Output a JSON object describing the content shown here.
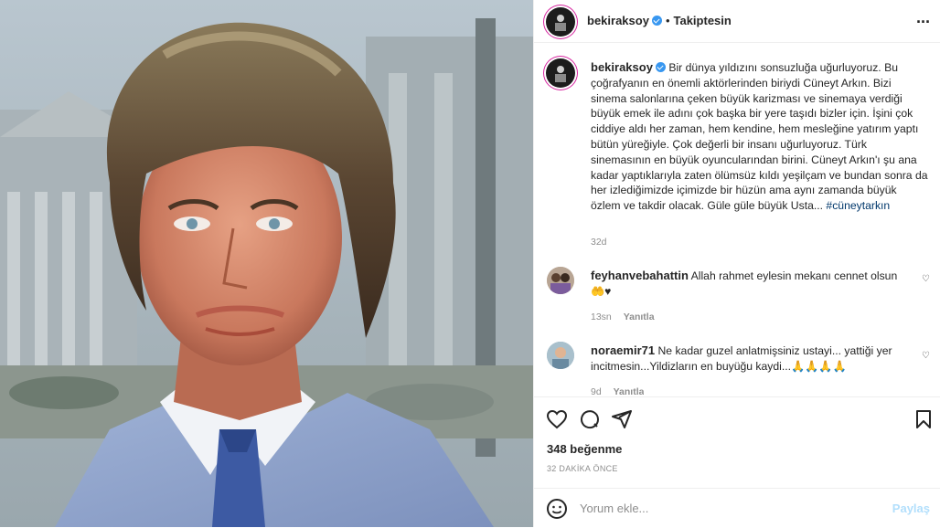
{
  "post": {
    "username": "bekiraksoy",
    "follow_status": "Takiptesin",
    "caption": "Bir dünya yıldızını sonsuzluğa uğurluyoruz. Bu çoğrafyanın en önemli aktörlerinden biriydi Cüneyt Arkın. Bizi sinema salonlarına çeken büyük karizması ve sinemaya verdiği büyük emek ile adını çok başka bir yere taşıdı bizler için. İşini çok ciddiye aldı her zaman, hem kendine, hem mesleğine yatırım yaptı bütün yüreğiyle. Çok değerli bir insanı uğurluyoruz. Türk sinemasının en büyük oyuncularından birini. Cüneyt Arkın'ı şu ana kadar yaptıklarıyla zaten ölümsüz kıldı yeşilçam ve bundan sonra da her izlediğimizde içimizde bir hüzün ama aynı zamanda büyük özlem ve takdir olacak. Güle güle büyük Usta...",
    "hashtag": "#cüneytarkın",
    "caption_age": "32d",
    "likes": "348 beğenme",
    "time_ago": "32 DAKİKA ÖNCE"
  },
  "comments": [
    {
      "username": "feyhanvebahattin",
      "text": "Allah rahmet eylesin mekanı cennet olsun 🤲♥",
      "age": "13sn",
      "reply": "Yanıtla"
    },
    {
      "username": "noraemir71",
      "text": "Ne kadar guzel anlatmişsiniz ustayi... yattiği yer incitmesin...Yildizların en buyüğu kaydi...🙏🙏🙏🙏",
      "age": "9d",
      "reply": "Yanıtla"
    }
  ],
  "composer": {
    "placeholder": "Yorum ekle...",
    "share_label": "Paylaş"
  },
  "icons": [
    "more-icon",
    "heart-icon",
    "comment-icon",
    "share-icon",
    "bookmark-icon",
    "emoji-icon",
    "verified-icon"
  ],
  "colors": {
    "verified": "#3897f0",
    "link": "#00376b",
    "share_disabled": "#b2dffc",
    "muted": "#8e8e8e"
  }
}
